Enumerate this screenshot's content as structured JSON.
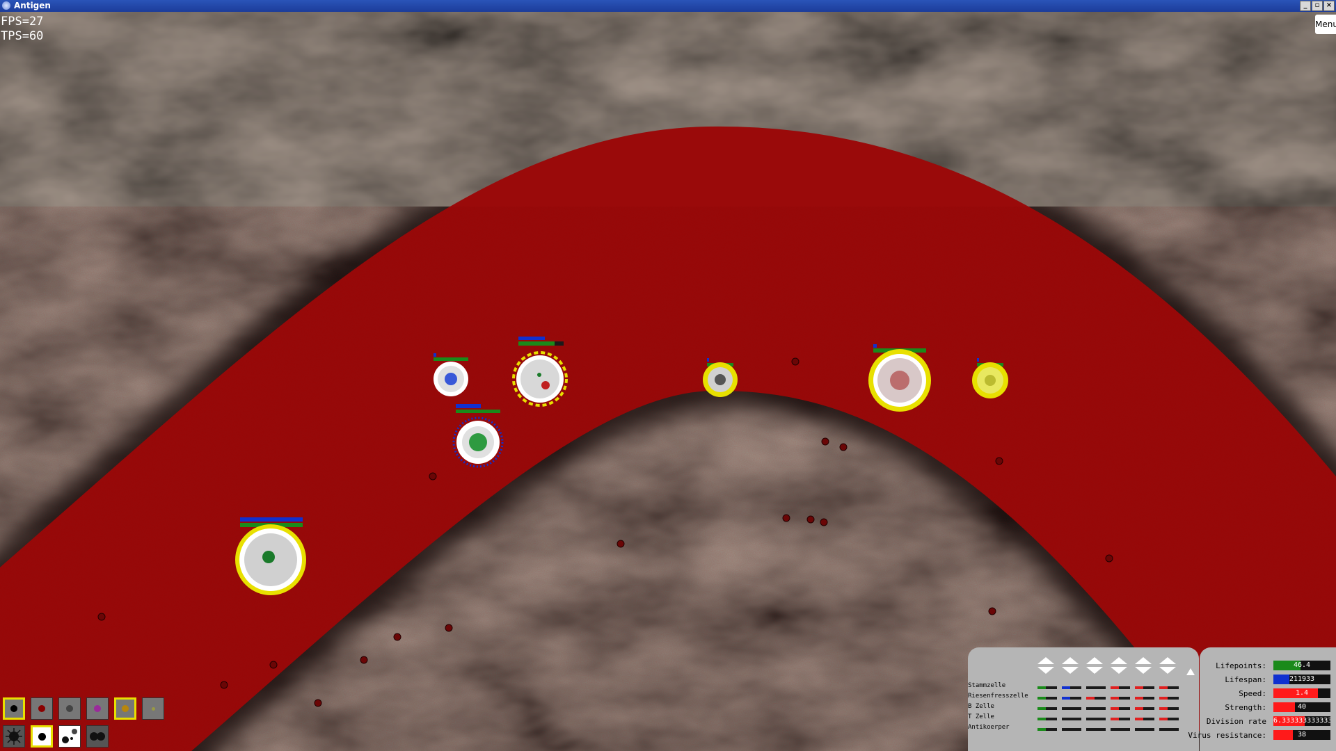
{
  "window": {
    "title": "Antigen",
    "controls": [
      "_",
      "▫",
      "×"
    ]
  },
  "hud": {
    "fps": "FPS=27",
    "tps": "TPS=60",
    "menu_label": "Menu"
  },
  "colors": {
    "blood": "#9a0a0a",
    "tissue": "#2a1e17",
    "selection": "#e8e000",
    "panel": "#b5b5b5"
  },
  "cells": [
    {
      "type": "stem-cell",
      "core": "#e0e0e0",
      "ring": "#ffffff",
      "nucleus": "#3858d8",
      "bars": [
        "green",
        "blue"
      ]
    },
    {
      "type": "macrophage",
      "core": "#d8d8d8",
      "ring": "#e8e000",
      "nucleus": "#c02020",
      "bars": [
        "green",
        "blue"
      ]
    },
    {
      "type": "b-cell",
      "core": "#e0e0e0",
      "ring": "#ffffff",
      "nucleus": "#2e9a40",
      "bars": [
        "green",
        "blue"
      ]
    },
    {
      "type": "t-cell",
      "core": "#d0d0d0",
      "ring": "#e8e000",
      "nucleus": "#555555",
      "bars": [
        "green"
      ]
    },
    {
      "type": "antibody-producer",
      "core": "#d8c8c8",
      "ring": "#e8e000",
      "nucleus": "#a83030",
      "bars": [
        "green"
      ]
    },
    {
      "type": "small-cell",
      "core": "#e8e860",
      "ring": "#e8e000",
      "nucleus": "#bbbb30",
      "bars": [
        "green"
      ]
    },
    {
      "type": "large-cell",
      "core": "#d0d0d0",
      "ring": "#e8e000",
      "nucleus": "#1a7a2a",
      "bars": [
        "green",
        "blue"
      ]
    }
  ],
  "toolbar": {
    "cell_slots": [
      {
        "icon": "black-dot-icon",
        "color": "#000000",
        "selected": true
      },
      {
        "icon": "red-dot-icon",
        "color": "#8a0000",
        "selected": false
      },
      {
        "icon": "gray-dot-icon",
        "color": "#444444",
        "selected": false
      },
      {
        "icon": "purple-dot-icon",
        "color": "#9a2a9a",
        "selected": false
      },
      {
        "icon": "orange-dot-icon",
        "color": "#b8860b",
        "selected": true
      },
      {
        "icon": "olive-dot-icon",
        "color": "#999944",
        "selected": false
      }
    ],
    "mode_slots": [
      {
        "icon": "virus-icon",
        "selected": false
      },
      {
        "icon": "single-cell-icon",
        "selected": true
      },
      {
        "icon": "scatter-icon",
        "selected": false
      },
      {
        "icon": "pair-icon",
        "selected": false
      }
    ]
  },
  "gene_panel": {
    "rows": [
      "Stammzelle",
      "Riesenfresszelle",
      "B Zelle",
      "T Zelle",
      "Antikoerper"
    ],
    "columns": 6,
    "segments": [
      [
        "#1a8a1a",
        "#1030d0",
        "#222222",
        "#e02020",
        "#e02020",
        "#e02020"
      ],
      [
        "#1a8a1a",
        "#1030d0",
        "#e02020",
        "#e02020",
        "#e02020",
        "#e02020"
      ],
      [
        "#1a8a1a",
        "#222222",
        "#222222",
        "#e02020",
        "#e02020",
        "#e02020"
      ],
      [
        "#1a8a1a",
        "#222222",
        "#222222",
        "#e02020",
        "#e02020",
        "#e02020"
      ],
      [
        "#1a8a1a",
        "#222222",
        "#222222",
        "#222222",
        "#222222",
        "#222222"
      ]
    ]
  },
  "stats": [
    {
      "label": "Lifepoints:",
      "value": "46.4",
      "color": "#1a8a1a",
      "fill": 0.48
    },
    {
      "label": "Lifespan:",
      "value": "211933",
      "color": "#1030d0",
      "fill": 0.28
    },
    {
      "label": "Speed:",
      "value": "1.4",
      "color": "#ff1a1a",
      "fill": 0.78
    },
    {
      "label": "Strength:",
      "value": "40",
      "color": "#ff1a1a",
      "fill": 0.38
    },
    {
      "label": "Division rate",
      "value": "6.333333333333333",
      "color": "#ff1a1a",
      "fill": 0.55
    },
    {
      "label": "Virus resistance:",
      "value": "38",
      "color": "#ff1a1a",
      "fill": 0.34
    }
  ]
}
